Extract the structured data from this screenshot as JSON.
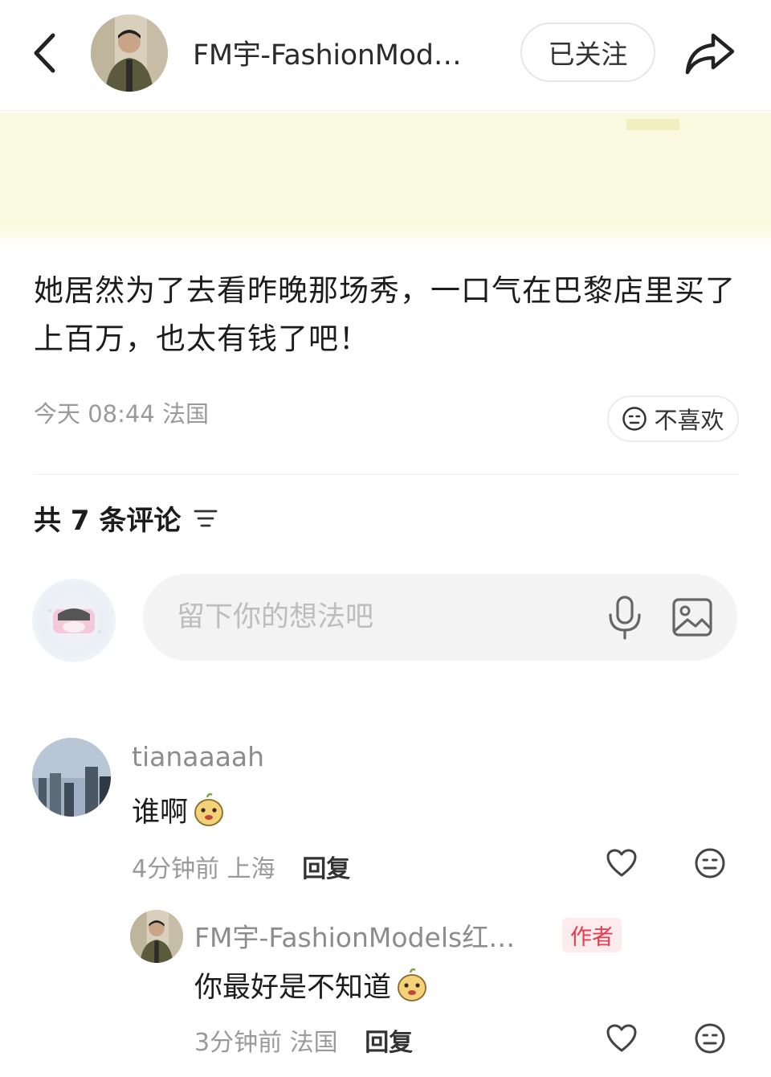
{
  "header": {
    "author_name": "FM宇-FashionMod…",
    "follow_label": "已关注"
  },
  "post": {
    "text": "她居然为了去看昨晚那场秀，一口气在巴黎店里买了上百万，也太有钱了吧！",
    "time": "今天 08:44",
    "location": "法国",
    "dislike_label": "不喜欢"
  },
  "comments_header": {
    "count_label": "共 7 条评论"
  },
  "comment_input": {
    "placeholder": "留下你的想法吧"
  },
  "comments": [
    {
      "username": "tianaaaah",
      "text": "谁啊",
      "time": "4分钟前",
      "location": "上海",
      "reply_label": "回复"
    },
    {
      "username": "FM宇-FashionModels红…",
      "badge": "作者",
      "text": "你最好是不知道",
      "time": "3分钟前",
      "location": "法国",
      "reply_label": "回复"
    }
  ],
  "icons": [
    "back-icon",
    "share-icon",
    "dislike-face-icon",
    "sort-icon",
    "microphone-icon",
    "image-icon",
    "heart-icon",
    "face-icon",
    "emoji-icon"
  ],
  "colors": {
    "badge_text": "#e63a4d",
    "badge_bg": "#fdecee",
    "media_bg": "#f8f9df"
  }
}
